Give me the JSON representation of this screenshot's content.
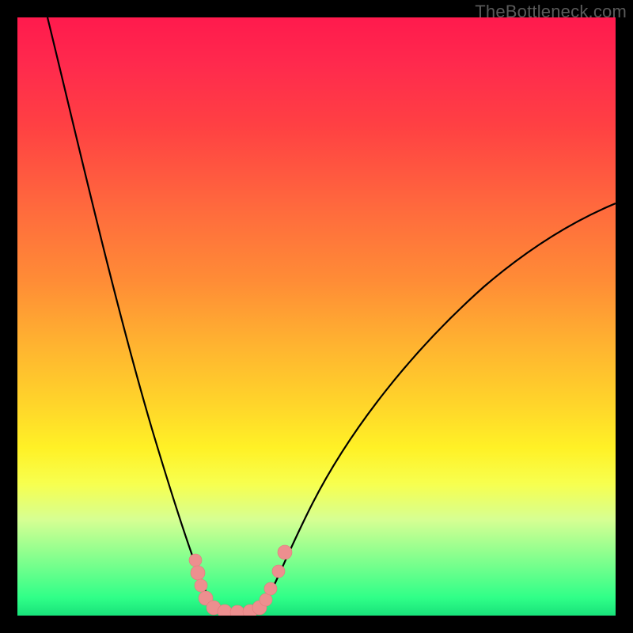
{
  "watermark": "TheBottleneck.com",
  "chart_data": {
    "type": "line",
    "title": "",
    "xlabel": "",
    "ylabel": "",
    "xlim": [
      0,
      100
    ],
    "ylim": [
      0,
      100
    ],
    "grid": false,
    "legend": false,
    "series": [
      {
        "name": "left-curve",
        "values": [
          {
            "x": 5,
            "y": 100
          },
          {
            "x": 8,
            "y": 84
          },
          {
            "x": 12,
            "y": 63
          },
          {
            "x": 16,
            "y": 44
          },
          {
            "x": 20,
            "y": 28
          },
          {
            "x": 24,
            "y": 15
          },
          {
            "x": 27,
            "y": 8
          },
          {
            "x": 29,
            "y": 4
          },
          {
            "x": 30,
            "y": 2
          },
          {
            "x": 31,
            "y": 1
          },
          {
            "x": 32,
            "y": 0.5
          },
          {
            "x": 34,
            "y": 0.3
          },
          {
            "x": 36,
            "y": 0.3
          }
        ]
      },
      {
        "name": "right-curve",
        "values": [
          {
            "x": 36,
            "y": 0.3
          },
          {
            "x": 38,
            "y": 0.4
          },
          {
            "x": 40,
            "y": 1
          },
          {
            "x": 41,
            "y": 2
          },
          {
            "x": 42,
            "y": 4
          },
          {
            "x": 44,
            "y": 8
          },
          {
            "x": 48,
            "y": 16
          },
          {
            "x": 55,
            "y": 28
          },
          {
            "x": 64,
            "y": 40
          },
          {
            "x": 74,
            "y": 50
          },
          {
            "x": 85,
            "y": 58
          },
          {
            "x": 95,
            "y": 65
          },
          {
            "x": 100,
            "y": 68
          }
        ]
      },
      {
        "name": "markers",
        "values": [
          {
            "x": 29,
            "y": 10
          },
          {
            "x": 29.5,
            "y": 7.5
          },
          {
            "x": 30,
            "y": 5
          },
          {
            "x": 30.5,
            "y": 3
          },
          {
            "x": 31.5,
            "y": 1.2
          },
          {
            "x": 33,
            "y": 0.6
          },
          {
            "x": 35,
            "y": 0.6
          },
          {
            "x": 37,
            "y": 0.6
          },
          {
            "x": 38.5,
            "y": 0.8
          },
          {
            "x": 39.5,
            "y": 1.5
          },
          {
            "x": 40.5,
            "y": 3
          },
          {
            "x": 41.5,
            "y": 5.5
          },
          {
            "x": 43,
            "y": 9
          }
        ]
      }
    ],
    "background_gradient": {
      "top": "#ff1a4d",
      "middle": "#fff126",
      "bottom": "#18e27a"
    },
    "marker_color": "#f19090",
    "curve_color": "#000000"
  }
}
